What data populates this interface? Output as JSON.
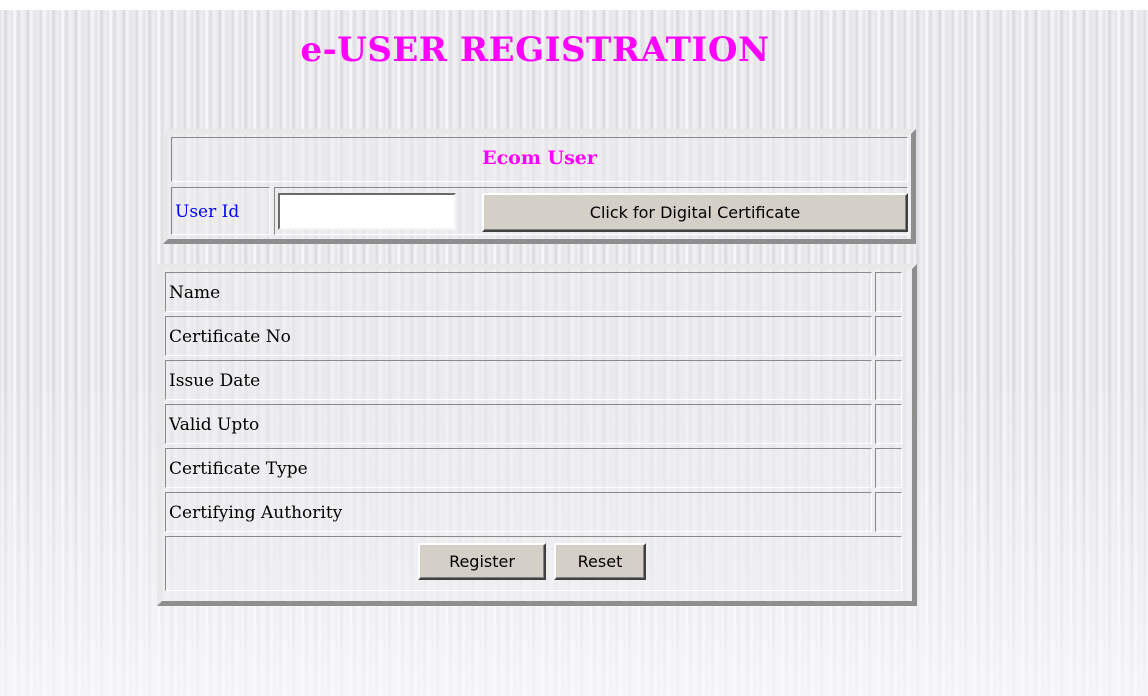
{
  "page": {
    "title": "e-USER REGISTRATION"
  },
  "ecom_user": {
    "heading": "Ecom User",
    "user_id_label": "User Id",
    "user_id_value": "",
    "certificate_button_label": "Click for Digital Certificate"
  },
  "certificate": {
    "rows": [
      {
        "label": "Name",
        "value": ""
      },
      {
        "label": "Certificate No",
        "value": ""
      },
      {
        "label": "Issue Date",
        "value": ""
      },
      {
        "label": "Valid Upto",
        "value": ""
      },
      {
        "label": "Certificate Type",
        "value": ""
      },
      {
        "label": "Certifying Authority",
        "value": ""
      }
    ],
    "register_label": "Register",
    "reset_label": "Reset"
  },
  "colors": {
    "title": "#ff00ff",
    "heading": "#ff00ff",
    "label": "#0000ff",
    "button_face": "#d4d0c8"
  }
}
